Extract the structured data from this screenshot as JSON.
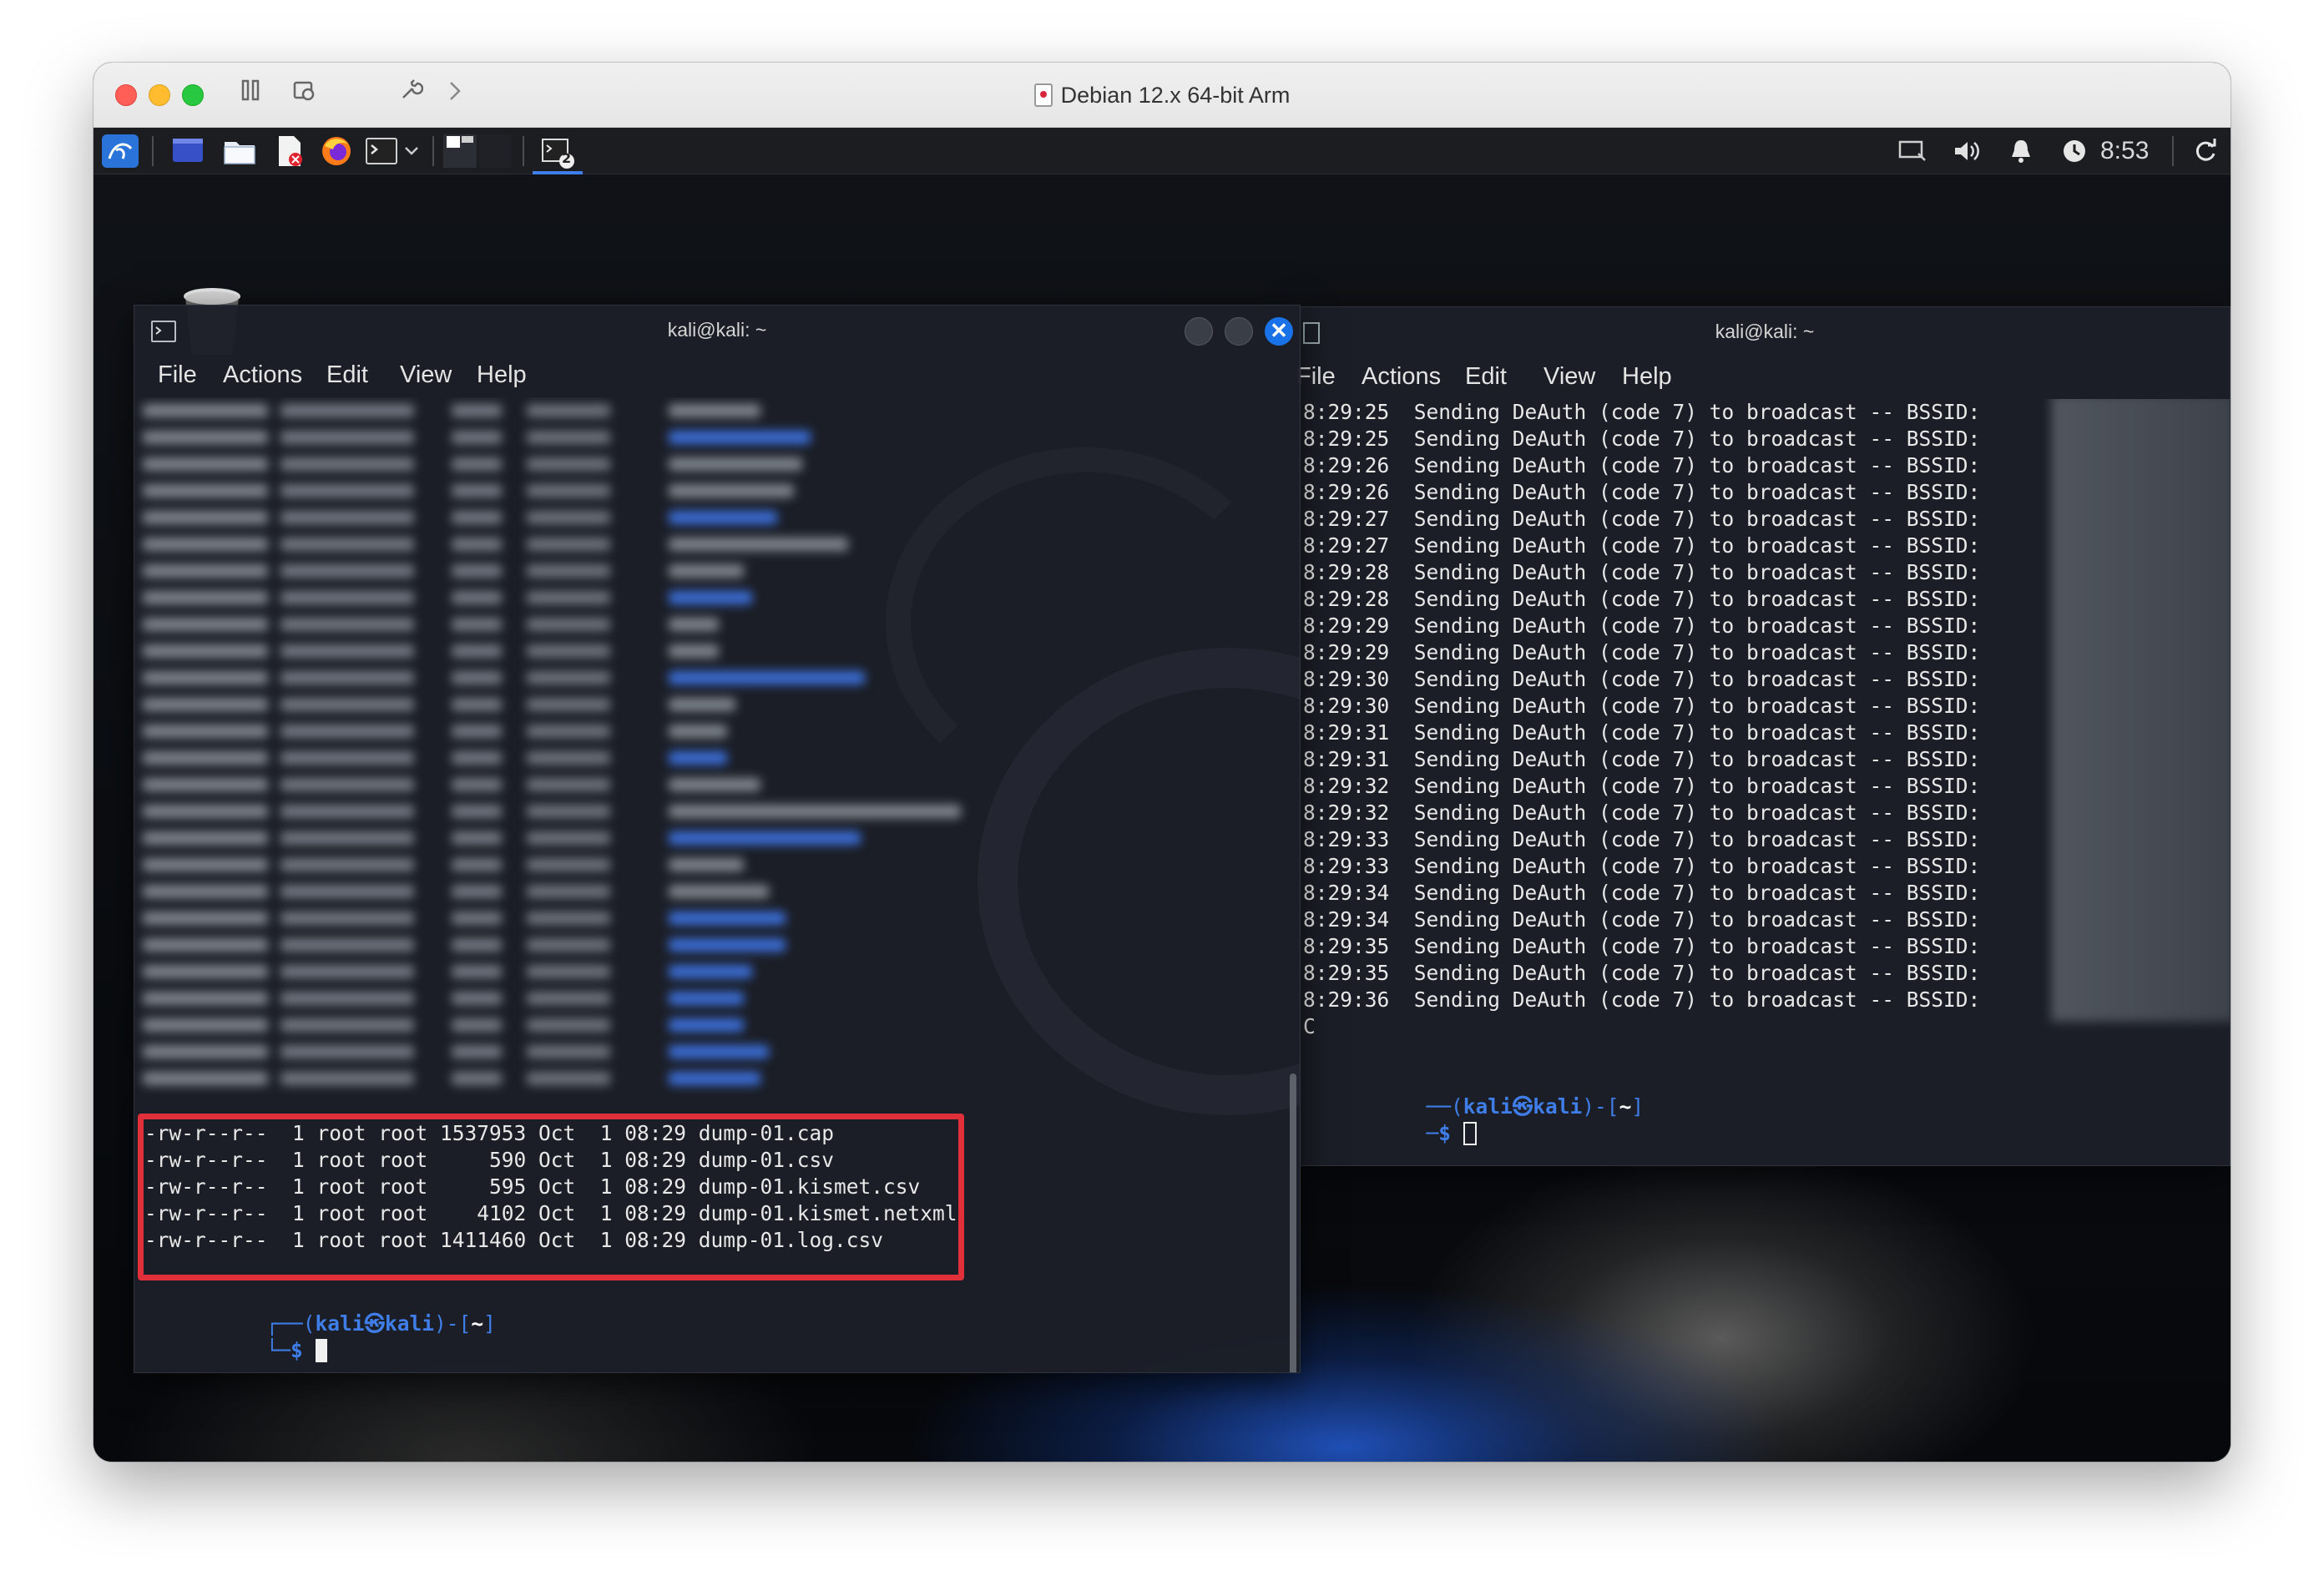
{
  "vm_window": {
    "title": "Debian 12.x 64-bit Arm"
  },
  "panel": {
    "clock": "8:53",
    "workspace_number": "2"
  },
  "terminal_left": {
    "title": "kali@kali: ~",
    "menu": [
      "File",
      "Actions",
      "Edit",
      "View",
      "Help"
    ],
    "visible_lines": [
      "-rw-r--r--  1 root root 1537953 Oct  1 08:29 dump-01.cap",
      "-rw-r--r--  1 root root     590 Oct  1 08:29 dump-01.csv",
      "-rw-r--r--  1 root root     595 Oct  1 08:29 dump-01.kismet.csv",
      "-rw-r--r--  1 root root    4102 Oct  1 08:29 dump-01.kismet.netxml",
      "-rw-r--r--  1 root root 1411460 Oct  1 08:29 dump-01.log.csv"
    ],
    "prompt_line1": "┌──(kali㉿kali)-[~]",
    "prompt_user": "kali㉿kali",
    "prompt_dir": "~",
    "prompt_symbol": "$"
  },
  "terminal_right": {
    "title": "kali@kali: ~",
    "menu": [
      "File",
      "Actions",
      "Edit",
      "View",
      "Help"
    ],
    "deauth_lines": [
      {
        "time": "8:29:25",
        "text": "Sending DeAuth (code 7) to broadcast -- BSSID:"
      },
      {
        "time": "8:29:25",
        "text": "Sending DeAuth (code 7) to broadcast -- BSSID:"
      },
      {
        "time": "8:29:26",
        "text": "Sending DeAuth (code 7) to broadcast -- BSSID:"
      },
      {
        "time": "8:29:26",
        "text": "Sending DeAuth (code 7) to broadcast -- BSSID:"
      },
      {
        "time": "8:29:27",
        "text": "Sending DeAuth (code 7) to broadcast -- BSSID:"
      },
      {
        "time": "8:29:27",
        "text": "Sending DeAuth (code 7) to broadcast -- BSSID:"
      },
      {
        "time": "8:29:28",
        "text": "Sending DeAuth (code 7) to broadcast -- BSSID:"
      },
      {
        "time": "8:29:28",
        "text": "Sending DeAuth (code 7) to broadcast -- BSSID:"
      },
      {
        "time": "8:29:29",
        "text": "Sending DeAuth (code 7) to broadcast -- BSSID:"
      },
      {
        "time": "8:29:29",
        "text": "Sending DeAuth (code 7) to broadcast -- BSSID:"
      },
      {
        "time": "8:29:30",
        "text": "Sending DeAuth (code 7) to broadcast -- BSSID:"
      },
      {
        "time": "8:29:30",
        "text": "Sending DeAuth (code 7) to broadcast -- BSSID:"
      },
      {
        "time": "8:29:31",
        "text": "Sending DeAuth (code 7) to broadcast -- BSSID:"
      },
      {
        "time": "8:29:31",
        "text": "Sending DeAuth (code 7) to broadcast -- BSSID:"
      },
      {
        "time": "8:29:32",
        "text": "Sending DeAuth (code 7) to broadcast -- BSSID:"
      },
      {
        "time": "8:29:32",
        "text": "Sending DeAuth (code 7) to broadcast -- BSSID:"
      },
      {
        "time": "8:29:33",
        "text": "Sending DeAuth (code 7) to broadcast -- BSSID:"
      },
      {
        "time": "8:29:33",
        "text": "Sending DeAuth (code 7) to broadcast -- BSSID:"
      },
      {
        "time": "8:29:34",
        "text": "Sending DeAuth (code 7) to broadcast -- BSSID:"
      },
      {
        "time": "8:29:34",
        "text": "Sending DeAuth (code 7) to broadcast -- BSSID:"
      },
      {
        "time": "8:29:35",
        "text": "Sending DeAuth (code 7) to broadcast -- BSSID:"
      },
      {
        "time": "8:29:35",
        "text": "Sending DeAuth (code 7) to broadcast -- BSSID:"
      },
      {
        "time": "8:29:36",
        "text": "Sending DeAuth (code 7) to broadcast -- BSSID:"
      }
    ],
    "interrupt": "C",
    "prompt_line1": "──(kali㉿kali)-[~]",
    "prompt_user": "kali㉿kali",
    "prompt_dir": "~",
    "prompt_symbol": "$"
  },
  "colors": {
    "highlight": "#e2303a",
    "prompt": "#3f7ee8",
    "close_button": "#1a72e8"
  },
  "icons": [
    "kali-menu-icon",
    "desktop-icon",
    "file-manager-icon",
    "text-editor-icon",
    "firefox-icon",
    "terminal-icon",
    "workspace-switcher-icon",
    "screen-icon",
    "volume-icon",
    "bell-icon",
    "power-icon",
    "refresh-icon",
    "trash-icon"
  ]
}
